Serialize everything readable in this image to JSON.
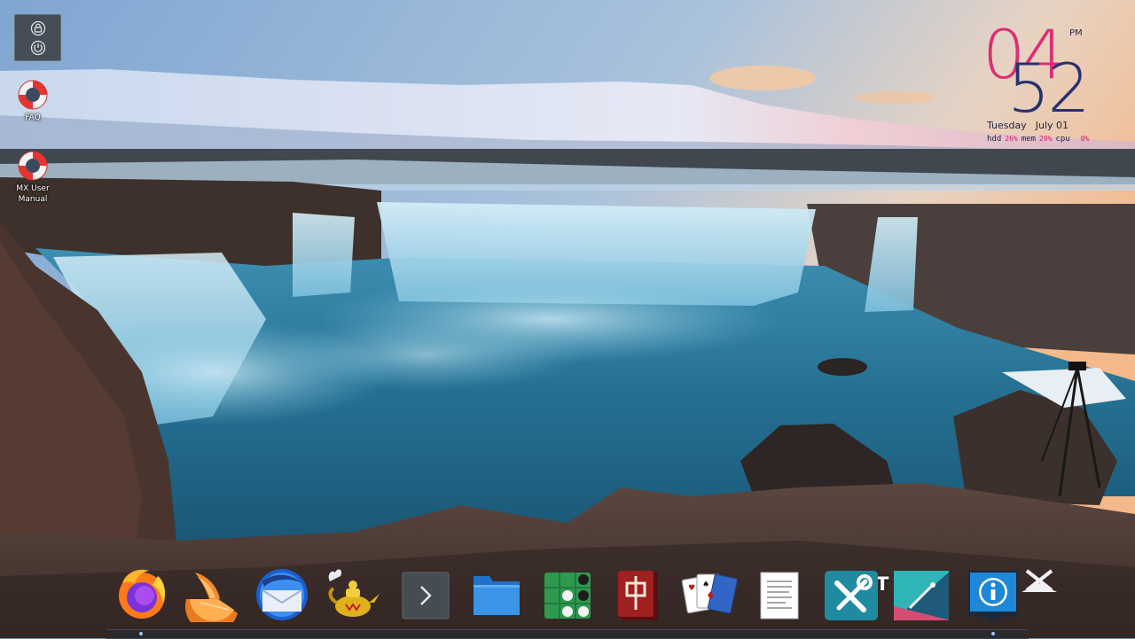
{
  "desktop": {
    "session_panel": {
      "items": [
        {
          "name": "lock-icon"
        },
        {
          "name": "power-icon"
        }
      ]
    },
    "icons": [
      {
        "label": "FAQ",
        "icon": "lifebuoy-icon"
      },
      {
        "label": "MX User\nManual",
        "icon": "lifebuoy-icon"
      }
    ]
  },
  "clock": {
    "hour": "04",
    "minute": "52",
    "ampm": "PM",
    "day": "Tuesday",
    "date": "July 01",
    "hdd_label": "hdd",
    "hdd_value": "26%",
    "mem_label": "mem",
    "mem_value": "29%",
    "cpu_label": "cpu",
    "cpu_value": "0%",
    "colors": {
      "hour": "#dc1e6e",
      "minute": "#28326e"
    }
  },
  "dock": {
    "peek_text": "T      ir",
    "items": [
      {
        "app": "Firefox",
        "icon": "firefox-icon"
      },
      {
        "app": "Clementine",
        "icon": "clementine-icon"
      },
      {
        "app": "Thunderbird",
        "icon": "thunderbird-icon"
      },
      {
        "app": "Magic Lamp",
        "icon": "genie-lamp-icon"
      },
      {
        "app": "Terminal",
        "icon": "terminal-icon"
      },
      {
        "app": "File Manager",
        "icon": "folder-icon"
      },
      {
        "app": "Reversi",
        "icon": "reversi-icon"
      },
      {
        "app": "Mahjongg",
        "icon": "mahjong-tile-icon"
      },
      {
        "app": "Solitaire",
        "icon": "playing-cards-icon"
      },
      {
        "app": "Text Editor",
        "icon": "document-icon"
      },
      {
        "app": "MX Tools",
        "icon": "tools-icon"
      },
      {
        "app": "MX Tweak",
        "icon": "tweak-icon"
      },
      {
        "app": "System Info",
        "icon": "info-icon"
      },
      {
        "app": "Settings",
        "icon": "wrench-cross-icon"
      }
    ]
  }
}
